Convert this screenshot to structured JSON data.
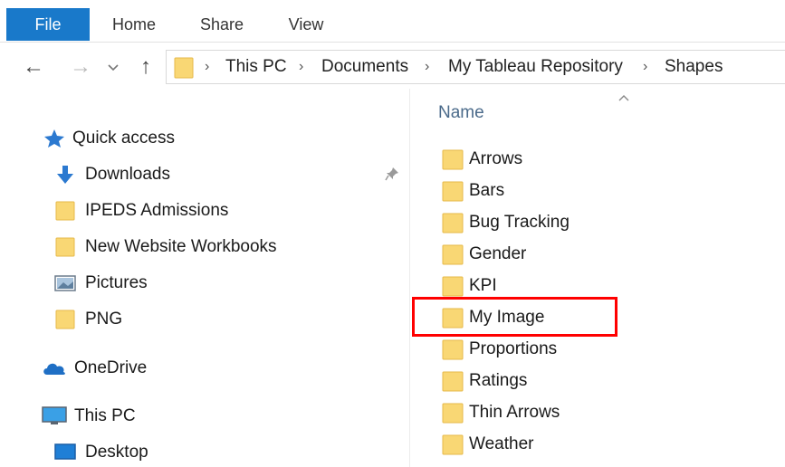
{
  "ribbon": {
    "tabs": [
      "File",
      "Home",
      "Share",
      "View"
    ],
    "active_tab": "File",
    "accent_color": "#1979ca"
  },
  "navigation": {
    "back_icon": "arrow-left-icon",
    "forward_icon": "arrow-right-icon",
    "recent_icon": "chevron-down-icon",
    "up_icon": "arrow-up-icon",
    "breadcrumb": [
      "This PC",
      "Documents",
      "My Tableau Repository",
      "Shapes"
    ]
  },
  "nav_pane": {
    "items": [
      {
        "label": "Quick access",
        "icon": "star-icon"
      },
      {
        "label": "Downloads",
        "icon": "download-icon",
        "pinned": true
      },
      {
        "label": "IPEDS Admissions",
        "icon": "folder-icon"
      },
      {
        "label": "New Website Workbooks",
        "icon": "folder-icon"
      },
      {
        "label": "Pictures",
        "icon": "pictures-icon"
      },
      {
        "label": "PNG",
        "icon": "folder-icon"
      },
      {
        "label": "OneDrive",
        "icon": "cloud-icon"
      },
      {
        "label": "This PC",
        "icon": "computer-icon"
      },
      {
        "label": "Desktop",
        "icon": "desktop-icon"
      }
    ]
  },
  "file_list": {
    "column_header": "Name",
    "sort_icon": "chevron-up-icon",
    "items": [
      "Arrows",
      "Bars",
      "Bug Tracking",
      "Gender",
      "KPI",
      "My Image",
      "Proportions",
      "Ratings",
      "Thin Arrows",
      "Weather"
    ],
    "highlighted_item": "My Image",
    "highlight_color": "#ff0000"
  }
}
